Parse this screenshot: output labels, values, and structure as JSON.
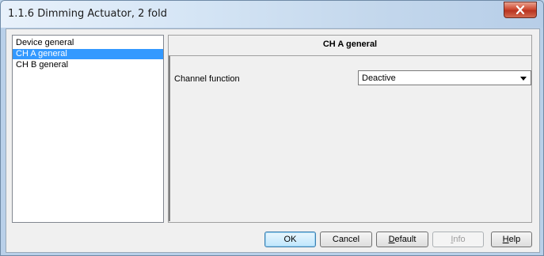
{
  "window": {
    "title": "1.1.6 Dimming Actuator, 2 fold"
  },
  "sidebar": {
    "items": [
      {
        "label": "Device general",
        "selected": false
      },
      {
        "label": "CH A general",
        "selected": true
      },
      {
        "label": "CH B general",
        "selected": false
      }
    ]
  },
  "panel": {
    "header": "CH A general",
    "fields": [
      {
        "label": "Channel function",
        "value": "Deactive"
      }
    ]
  },
  "buttons": {
    "ok": "OK",
    "cancel": "Cancel",
    "default_first": "D",
    "default_rest": "efault",
    "info_first": "I",
    "info_rest": "nfo",
    "help_first": "H",
    "help_rest": "elp"
  },
  "colors": {
    "selection": "#3399ff",
    "close": "#c94a33",
    "frame": "#b9d0e9"
  },
  "icons": {
    "close": "close-icon",
    "dropdown": "chevron-down-icon"
  }
}
